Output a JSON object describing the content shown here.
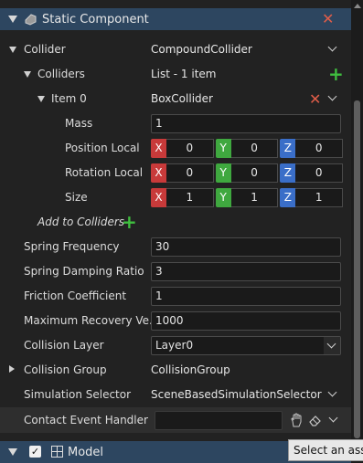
{
  "component": {
    "title": "Static Component",
    "properties": {
      "collider": {
        "label": "Collider",
        "value": "CompoundCollider"
      },
      "colliders": {
        "label": "Colliders",
        "value": "List - 1 item"
      },
      "item0": {
        "label": "Item 0",
        "value": "BoxCollider",
        "mass": {
          "label": "Mass",
          "value": "1"
        },
        "position_local": {
          "label": "Position Local",
          "x": "0",
          "y": "0",
          "z": "0"
        },
        "rotation_local": {
          "label": "Rotation Local",
          "x": "0",
          "y": "0",
          "z": "0"
        },
        "size": {
          "label": "Size",
          "x": "1",
          "y": "1",
          "z": "1"
        }
      },
      "add_to_colliders": "Add to Colliders",
      "spring_frequency": {
        "label": "Spring Frequency",
        "value": "30"
      },
      "spring_damping_ratio": {
        "label": "Spring Damping Ratio",
        "value": "3"
      },
      "friction_coefficient": {
        "label": "Friction Coefficient",
        "value": "1"
      },
      "max_recovery_velocity": {
        "label": "Maximum Recovery Ve...",
        "value": "1000"
      },
      "collision_layer": {
        "label": "Collision Layer",
        "value": "Layer0"
      },
      "collision_group": {
        "label": "Collision Group",
        "value": "CollisionGroup"
      },
      "simulation_selector": {
        "label": "Simulation Selector",
        "value": "SceneBasedSimulationSelector"
      },
      "contact_event_handler": {
        "label": "Contact Event Handler",
        "value": ""
      }
    }
  },
  "axis_labels": {
    "x": "X",
    "y": "Y",
    "z": "Z"
  },
  "next_component": {
    "title": "Model",
    "enabled_mark": "✓"
  },
  "tooltip": "Select an asset",
  "icons": {
    "remove": "✕",
    "add": "+"
  },
  "colors": {
    "header": "#2d4660",
    "remove": "#e05d49",
    "add": "#3fbf3f",
    "x_axis": "#c83a3a",
    "y_axis": "#3fa83f",
    "z_axis": "#3a6ec8"
  }
}
